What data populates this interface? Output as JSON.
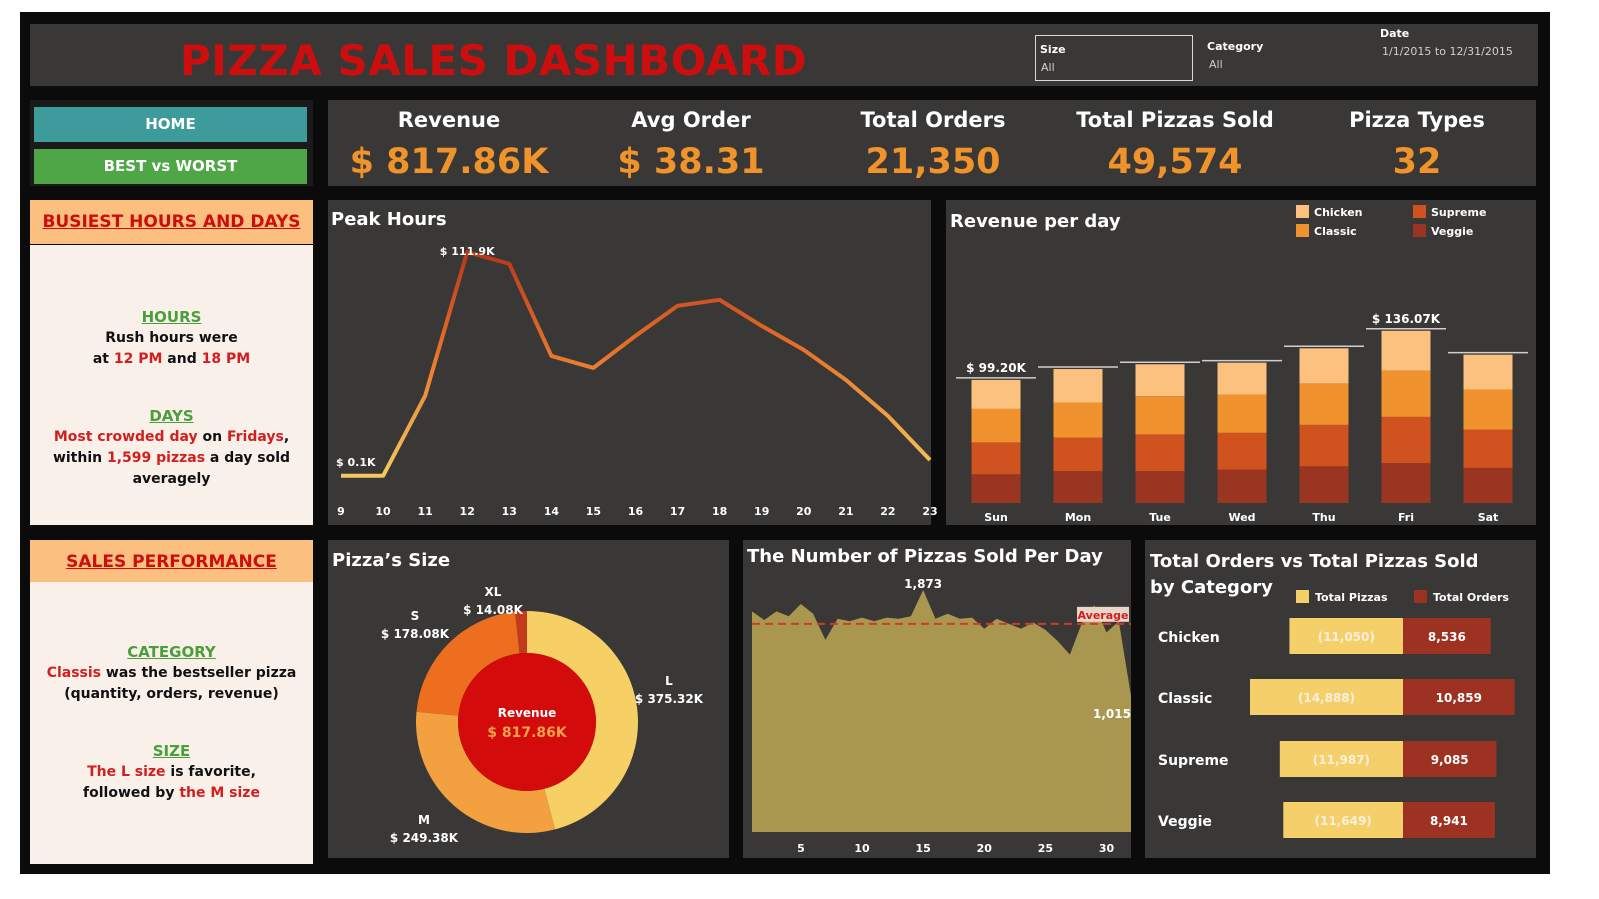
{
  "header": {
    "title": "PIZZA SALES DASHBOARD",
    "filters": {
      "size": {
        "label": "Size",
        "value": "All"
      },
      "category": {
        "label": "Category",
        "value": "All"
      },
      "date": {
        "label": "Date",
        "value": "1/1/2015 to 12/31/2015"
      }
    }
  },
  "nav": {
    "home": "HOME",
    "best_worst": "BEST vs WORST"
  },
  "kpis": [
    {
      "label": "Revenue",
      "value": "$ 817.86K"
    },
    {
      "label": "Avg Order",
      "value": "$ 38.31"
    },
    {
      "label": "Total Orders",
      "value": "21,350"
    },
    {
      "label": "Total Pizzas Sold",
      "value": "49,574"
    },
    {
      "label": "Pizza Types",
      "value": "32"
    }
  ],
  "busiest": {
    "title": "BUSIEST HOURS AND DAYS",
    "hours_title": "HOURS",
    "hours_line1": "Rush hours were",
    "hours_at": "at ",
    "hours_12": "12 PM",
    "hours_and": " and ",
    "hours_18": "18 PM",
    "days_title": "DAYS",
    "days_a": "Most crowded day",
    "days_on": " on ",
    "days_fri": "Fridays",
    "days_comma": ",",
    "days_within": "within ",
    "days_num": "1,599 pizzas",
    "days_tail": " a day sold averagely"
  },
  "performance": {
    "title": "SALES PERFORMANCE",
    "cat_title": "CATEGORY",
    "cat_a": "Classis",
    "cat_b": " was the bestseller pizza",
    "cat_c": "(quantity, orders, revenue)",
    "size_title": "SIZE",
    "size_a": "The L size",
    "size_b": " is favorite,",
    "size_c": "followed by ",
    "size_d": "the M size"
  },
  "chart_titles": {
    "peak": "Peak Hours",
    "revday": "Revenue per day",
    "size": "Pizza’s Size",
    "perday": "The Number of Pizzas Sold Per Day",
    "cat": "Total Orders vs Total Pizzas Sold by Category"
  },
  "chart_data": [
    {
      "id": "peak_hours",
      "type": "line",
      "x": [
        9,
        10,
        11,
        12,
        13,
        14,
        15,
        16,
        17,
        18,
        19,
        20,
        21,
        22,
        23
      ],
      "values": [
        0.1,
        0.1,
        40,
        111.9,
        106,
        60,
        54,
        70,
        85,
        88,
        75,
        63,
        48,
        30,
        8
      ],
      "labels": {
        "min": "$ 0.1K",
        "max": "$ 111.9K"
      },
      "colors": [
        "#f6c85f",
        "#e07020",
        "#c0401a"
      ]
    },
    {
      "id": "revenue_per_day",
      "type": "bar",
      "stacked": true,
      "categories": [
        "Sun",
        "Mon",
        "Tue",
        "Wed",
        "Thu",
        "Fri",
        "Sat"
      ],
      "series": [
        {
          "name": "Veggie",
          "color": "#9a3522",
          "values": [
            18,
            20,
            20,
            21,
            23,
            25,
            22
          ]
        },
        {
          "name": "Supreme",
          "color": "#d0521f",
          "values": [
            20,
            21,
            23,
            23,
            26,
            29,
            24
          ]
        },
        {
          "name": "Classic",
          "color": "#f0922e",
          "values": [
            21,
            22,
            24,
            24,
            26,
            29,
            25
          ]
        },
        {
          "name": "Chicken",
          "color": "#fcc17e",
          "values": [
            18.2,
            21,
            20,
            20,
            22,
            25,
            22
          ]
        }
      ],
      "totals_labeled": {
        "Sun": "$ 99.20K",
        "Fri": "$ 136.07K"
      },
      "legend": [
        "Chicken",
        "Classic",
        "Supreme",
        "Veggie"
      ],
      "ylim": [
        0,
        140
      ]
    },
    {
      "id": "pizza_size",
      "type": "pie",
      "donut": true,
      "slices": [
        {
          "name": "L",
          "label": "$ 375.32K",
          "value": 375.32,
          "color": "#f6d064"
        },
        {
          "name": "M",
          "label": "$ 249.38K",
          "value": 249.38,
          "color": "#f2a040"
        },
        {
          "name": "S",
          "label": "$ 178.08K",
          "value": 178.08,
          "color": "#ec6e1e"
        },
        {
          "name": "XL",
          "label": "$ 14.08K",
          "value": 14.08,
          "color": "#c63a1c"
        }
      ],
      "center_label": "Revenue",
      "center_value": "$ 817.86K"
    },
    {
      "id": "pizzas_per_day",
      "type": "area",
      "x_ticks": [
        5,
        10,
        15,
        20,
        25,
        30
      ],
      "values": [
        1700,
        1630,
        1700,
        1660,
        1760,
        1680,
        1470,
        1640,
        1620,
        1650,
        1620,
        1650,
        1640,
        1660,
        1873,
        1640,
        1680,
        1640,
        1650,
        1560,
        1640,
        1600,
        1560,
        1610,
        1550,
        1460,
        1350,
        1610,
        1750,
        1530,
        1620,
        1015
      ],
      "average": 1599,
      "average_label": "Average",
      "labels": {
        "max": "1,873",
        "last": "1,015"
      },
      "color": "#a9964f"
    },
    {
      "id": "orders_vs_pizzas",
      "type": "bar",
      "orientation": "horizontal",
      "categories": [
        "Chicken",
        "Classic",
        "Supreme",
        "Veggie"
      ],
      "series": [
        {
          "name": "Total Pizzas",
          "color": "#f5d06a",
          "values": [
            11050,
            14888,
            11987,
            11649
          ],
          "labels": [
            "(11,050)",
            "(14,888)",
            "(11,987)",
            "(11,649)"
          ]
        },
        {
          "name": "Total Orders",
          "color": "#9e3222",
          "values": [
            8536,
            10859,
            9085,
            8941
          ],
          "labels": [
            "8,536",
            "10,859",
            "9,085",
            "8,941"
          ]
        }
      ]
    }
  ]
}
